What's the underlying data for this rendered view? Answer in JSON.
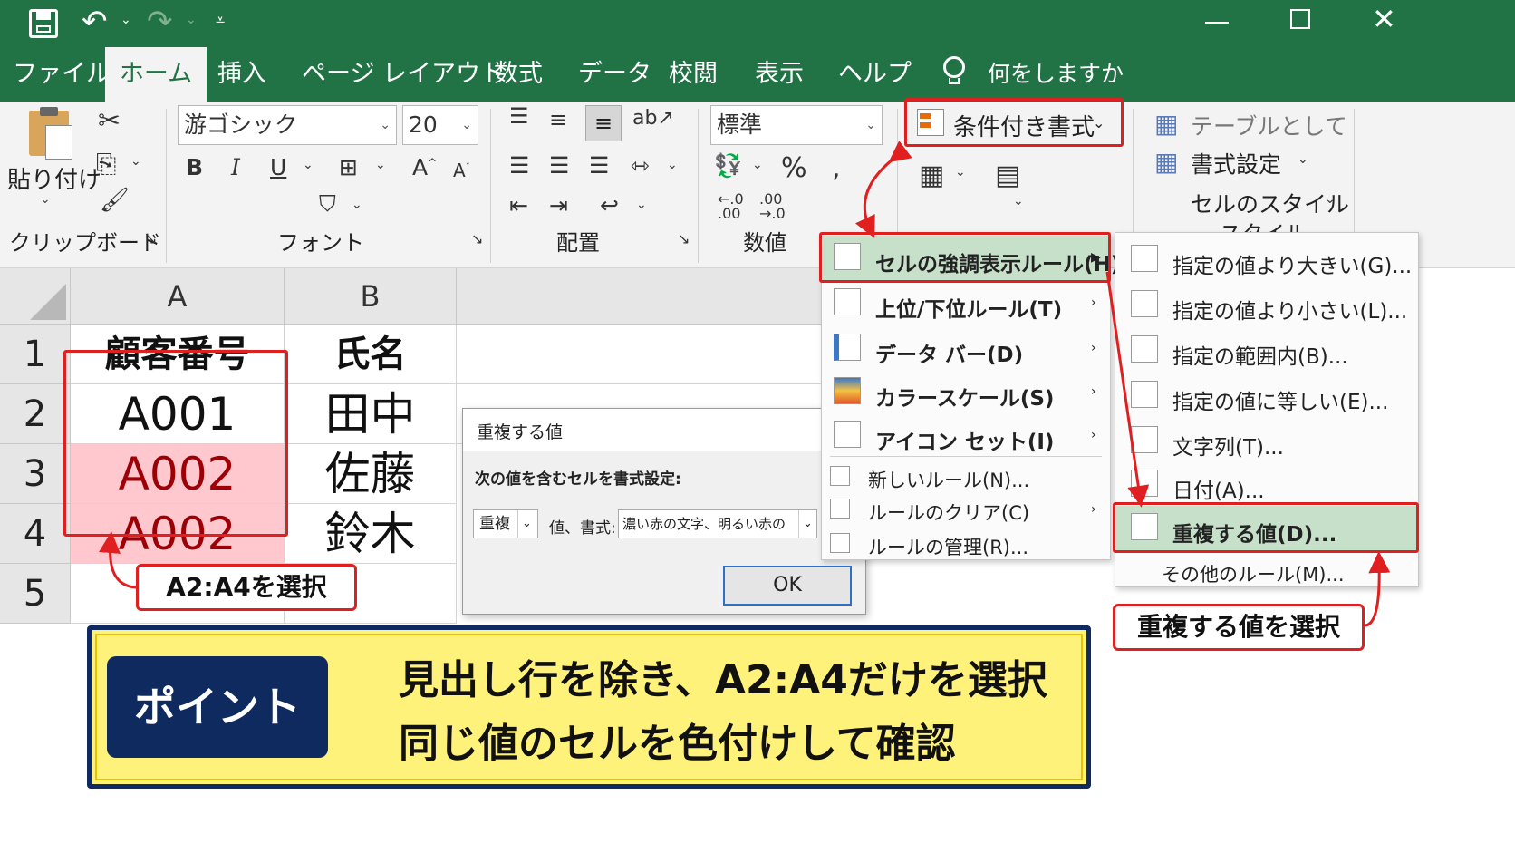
{
  "tabs": [
    "ファイル",
    "ホーム",
    "挿入",
    "ページ レイアウト",
    "数式",
    "データ",
    "校閲",
    "表示",
    "ヘルプ"
  ],
  "tell_me": "何をしますか",
  "ribbon": {
    "paste_label": "貼り付け",
    "group_clipboard": "クリップボード",
    "font_name": "游ゴシック",
    "font_size": "20",
    "group_font": "フォント",
    "group_alignment": "配置",
    "number_format": "標準",
    "group_number": "数値",
    "cond_format": "条件付き書式",
    "table_format": "テーブルとして",
    "table_format2": "書式設定",
    "cell_styles": "セルのスタイル",
    "group_styles": "スタイル"
  },
  "grid": {
    "col_a": "A",
    "col_b": "B",
    "rows": [
      "1",
      "2",
      "3",
      "4",
      "5"
    ],
    "a_values": [
      "顧客番号",
      "A001",
      "A002",
      "A002"
    ],
    "b_values": [
      "氏名",
      "田中",
      "佐藤",
      "鈴木"
    ]
  },
  "dialog": {
    "title": "重複する値",
    "prompt": "次の値を含むセルを書式設定:",
    "kind": "重複",
    "format_label": "値、書式:",
    "format_value": "濃い赤の文字、明るい赤の背景",
    "ok": "OK"
  },
  "menu1": {
    "items": [
      "セルの強調表示ルール(H)",
      "上位/下位ルール(T)",
      "データ バー(D)",
      "カラースケール(S)",
      "アイコン セット(I)",
      "新しいルール(N)...",
      "ルールのクリア(C)",
      "ルールの管理(R)..."
    ]
  },
  "menu2": {
    "items": [
      "指定の値より大きい(G)...",
      "指定の値より小さい(L)...",
      "指定の範囲内(B)...",
      "指定の値に等しい(E)...",
      "文字列(T)...",
      "日付(A)...",
      "重複する値(D)...",
      "その他のルール(M)..."
    ]
  },
  "callouts": {
    "select_range": "A2:A4を選択",
    "select_dup": "重複する値を選択"
  },
  "point": {
    "badge": "ポイント",
    "line1": "見出し行を除き、A2:A4だけを選択",
    "line2": "同じ値のセルを色付けして確認"
  },
  "colors": {
    "excel_green": "#217346",
    "highlight_bg": "#ffc7ce",
    "highlight_text": "#9c0006",
    "callout_red": "#e02020",
    "point_bg": "#fff27a",
    "point_badge": "#0f2a5f"
  }
}
